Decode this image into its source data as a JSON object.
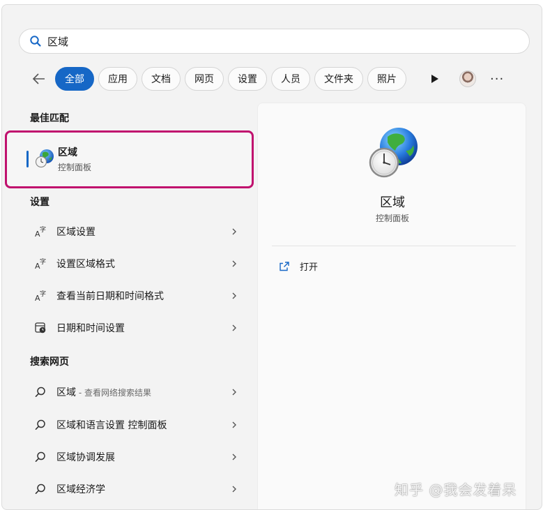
{
  "search": {
    "value": "区域"
  },
  "filters": {
    "items": [
      "全部",
      "应用",
      "文档",
      "网页",
      "设置",
      "人员",
      "文件夹",
      "照片"
    ],
    "active": "全部",
    "more_label": "···"
  },
  "left": {
    "best_match": {
      "section_title": "最佳匹配",
      "title": "区域",
      "subtitle": "控制面板",
      "icon": "globe-clock-icon"
    },
    "settings": {
      "section_title": "设置",
      "items": [
        {
          "label": "区域设置",
          "icon": "language-settings-icon"
        },
        {
          "label": "设置区域格式",
          "icon": "language-settings-icon"
        },
        {
          "label": "查看当前日期和时间格式",
          "icon": "language-settings-icon"
        },
        {
          "label": "日期和时间设置",
          "icon": "calendar-clock-icon"
        }
      ]
    },
    "web": {
      "section_title": "搜索网页",
      "items": [
        {
          "label": "区域",
          "suffix": " - 查看网络搜索结果",
          "icon": "search-icon"
        },
        {
          "label": "区域和语言设置 控制面板",
          "icon": "search-icon"
        },
        {
          "label": "区域协调发展",
          "icon": "search-icon"
        },
        {
          "label": "区域经济学",
          "icon": "search-icon"
        }
      ]
    }
  },
  "right": {
    "title": "区域",
    "subtitle": "控制面板",
    "action_label": "打开",
    "icon": "globe-clock-icon"
  },
  "watermark": "知乎 @我会发着呆",
  "colors": {
    "accent": "#1667c6",
    "highlight_border": "#c0116e"
  }
}
